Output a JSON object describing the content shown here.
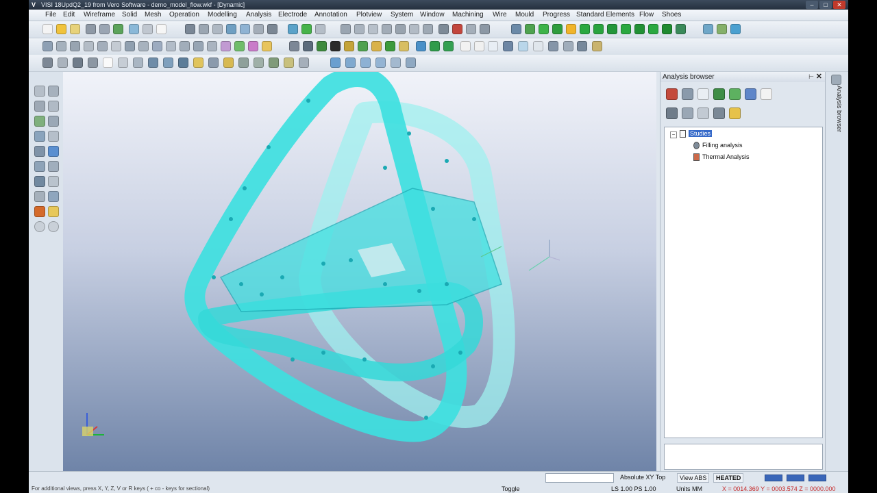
{
  "window": {
    "title": "VISI 18UpdQ2_19 from Vero Software - demo_model_flow.wkf - [Dynamic]",
    "logo": "V",
    "controls": [
      "–",
      "□",
      "✕"
    ]
  },
  "menubar": {
    "items": [
      "File",
      "Edit",
      "Wireframe",
      "Solid",
      "Mesh",
      "Operation",
      "Modelling",
      "Analysis",
      "Electrode",
      "Annotation",
      "Plotview",
      "System",
      "Window",
      "Machining",
      "Wire",
      "Mould",
      "Progress",
      "Standard Elements",
      "Flow",
      "Shoes"
    ]
  },
  "colors": {
    "model": "#3ee0e0",
    "model_edge": "#1aa9b3",
    "viewport_top": "#f1f3f9",
    "viewport_bottom": "#6f84a8",
    "selection": "#3569c9"
  },
  "analysis_browser": {
    "title": "Analysis browser",
    "pin": "⊢",
    "close": "✕",
    "tree": {
      "root": "Studies",
      "expander": "−",
      "children": [
        "Filling analysis",
        "Thermal Analysis"
      ]
    }
  },
  "side_tab": {
    "label": "Analysis browser"
  },
  "statusbar": {
    "hint": "For additional views, press X, Y, Z, V or R keys ( + co - keys for sectional)",
    "view_label": "Absolute XY Top",
    "view_abs": "View ABS",
    "heated": "HEATED",
    "toggle": "Toggle",
    "scale": "LS 1.00 PS 1.00",
    "units": "Units MM",
    "coords": "X = 0014.369 Y = 0003.574 Z = 0000.000"
  }
}
